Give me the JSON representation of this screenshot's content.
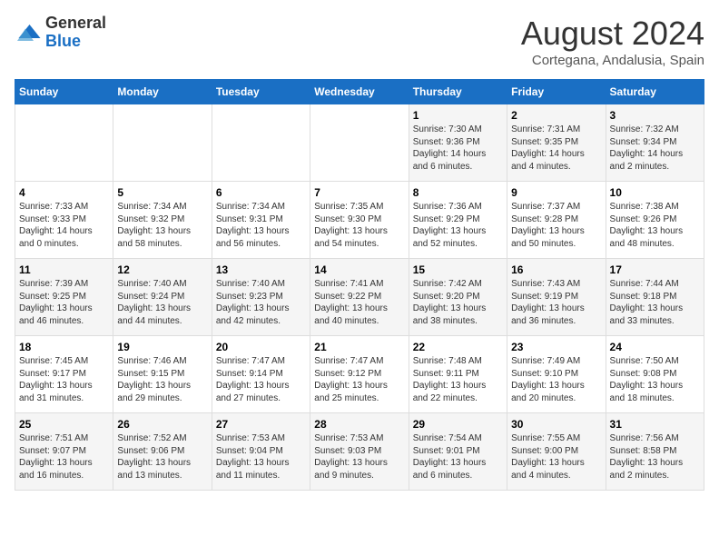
{
  "header": {
    "logo_general": "General",
    "logo_blue": "Blue",
    "month_title": "August 2024",
    "location": "Cortegana, Andalusia, Spain"
  },
  "weekdays": [
    "Sunday",
    "Monday",
    "Tuesday",
    "Wednesday",
    "Thursday",
    "Friday",
    "Saturday"
  ],
  "weeks": [
    [
      {
        "day": "",
        "info": ""
      },
      {
        "day": "",
        "info": ""
      },
      {
        "day": "",
        "info": ""
      },
      {
        "day": "",
        "info": ""
      },
      {
        "day": "1",
        "info": "Sunrise: 7:30 AM\nSunset: 9:36 PM\nDaylight: 14 hours\nand 6 minutes."
      },
      {
        "day": "2",
        "info": "Sunrise: 7:31 AM\nSunset: 9:35 PM\nDaylight: 14 hours\nand 4 minutes."
      },
      {
        "day": "3",
        "info": "Sunrise: 7:32 AM\nSunset: 9:34 PM\nDaylight: 14 hours\nand 2 minutes."
      }
    ],
    [
      {
        "day": "4",
        "info": "Sunrise: 7:33 AM\nSunset: 9:33 PM\nDaylight: 14 hours\nand 0 minutes."
      },
      {
        "day": "5",
        "info": "Sunrise: 7:34 AM\nSunset: 9:32 PM\nDaylight: 13 hours\nand 58 minutes."
      },
      {
        "day": "6",
        "info": "Sunrise: 7:34 AM\nSunset: 9:31 PM\nDaylight: 13 hours\nand 56 minutes."
      },
      {
        "day": "7",
        "info": "Sunrise: 7:35 AM\nSunset: 9:30 PM\nDaylight: 13 hours\nand 54 minutes."
      },
      {
        "day": "8",
        "info": "Sunrise: 7:36 AM\nSunset: 9:29 PM\nDaylight: 13 hours\nand 52 minutes."
      },
      {
        "day": "9",
        "info": "Sunrise: 7:37 AM\nSunset: 9:28 PM\nDaylight: 13 hours\nand 50 minutes."
      },
      {
        "day": "10",
        "info": "Sunrise: 7:38 AM\nSunset: 9:26 PM\nDaylight: 13 hours\nand 48 minutes."
      }
    ],
    [
      {
        "day": "11",
        "info": "Sunrise: 7:39 AM\nSunset: 9:25 PM\nDaylight: 13 hours\nand 46 minutes."
      },
      {
        "day": "12",
        "info": "Sunrise: 7:40 AM\nSunset: 9:24 PM\nDaylight: 13 hours\nand 44 minutes."
      },
      {
        "day": "13",
        "info": "Sunrise: 7:40 AM\nSunset: 9:23 PM\nDaylight: 13 hours\nand 42 minutes."
      },
      {
        "day": "14",
        "info": "Sunrise: 7:41 AM\nSunset: 9:22 PM\nDaylight: 13 hours\nand 40 minutes."
      },
      {
        "day": "15",
        "info": "Sunrise: 7:42 AM\nSunset: 9:20 PM\nDaylight: 13 hours\nand 38 minutes."
      },
      {
        "day": "16",
        "info": "Sunrise: 7:43 AM\nSunset: 9:19 PM\nDaylight: 13 hours\nand 36 minutes."
      },
      {
        "day": "17",
        "info": "Sunrise: 7:44 AM\nSunset: 9:18 PM\nDaylight: 13 hours\nand 33 minutes."
      }
    ],
    [
      {
        "day": "18",
        "info": "Sunrise: 7:45 AM\nSunset: 9:17 PM\nDaylight: 13 hours\nand 31 minutes."
      },
      {
        "day": "19",
        "info": "Sunrise: 7:46 AM\nSunset: 9:15 PM\nDaylight: 13 hours\nand 29 minutes."
      },
      {
        "day": "20",
        "info": "Sunrise: 7:47 AM\nSunset: 9:14 PM\nDaylight: 13 hours\nand 27 minutes."
      },
      {
        "day": "21",
        "info": "Sunrise: 7:47 AM\nSunset: 9:12 PM\nDaylight: 13 hours\nand 25 minutes."
      },
      {
        "day": "22",
        "info": "Sunrise: 7:48 AM\nSunset: 9:11 PM\nDaylight: 13 hours\nand 22 minutes."
      },
      {
        "day": "23",
        "info": "Sunrise: 7:49 AM\nSunset: 9:10 PM\nDaylight: 13 hours\nand 20 minutes."
      },
      {
        "day": "24",
        "info": "Sunrise: 7:50 AM\nSunset: 9:08 PM\nDaylight: 13 hours\nand 18 minutes."
      }
    ],
    [
      {
        "day": "25",
        "info": "Sunrise: 7:51 AM\nSunset: 9:07 PM\nDaylight: 13 hours\nand 16 minutes."
      },
      {
        "day": "26",
        "info": "Sunrise: 7:52 AM\nSunset: 9:06 PM\nDaylight: 13 hours\nand 13 minutes."
      },
      {
        "day": "27",
        "info": "Sunrise: 7:53 AM\nSunset: 9:04 PM\nDaylight: 13 hours\nand 11 minutes."
      },
      {
        "day": "28",
        "info": "Sunrise: 7:53 AM\nSunset: 9:03 PM\nDaylight: 13 hours\nand 9 minutes."
      },
      {
        "day": "29",
        "info": "Sunrise: 7:54 AM\nSunset: 9:01 PM\nDaylight: 13 hours\nand 6 minutes."
      },
      {
        "day": "30",
        "info": "Sunrise: 7:55 AM\nSunset: 9:00 PM\nDaylight: 13 hours\nand 4 minutes."
      },
      {
        "day": "31",
        "info": "Sunrise: 7:56 AM\nSunset: 8:58 PM\nDaylight: 13 hours\nand 2 minutes."
      }
    ]
  ]
}
